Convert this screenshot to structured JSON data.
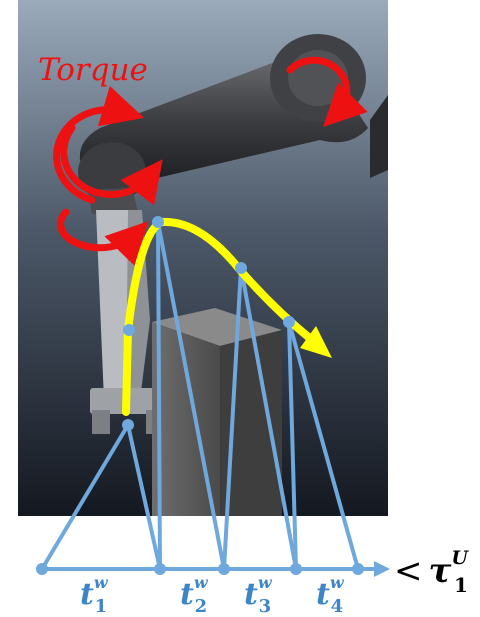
{
  "figure": {
    "torque_label": "Torque",
    "time_labels": [
      {
        "base": "t",
        "sub": "1",
        "sup": "w"
      },
      {
        "base": "t",
        "sub": "2",
        "sup": "w"
      },
      {
        "base": "t",
        "sub": "3",
        "sup": "w"
      },
      {
        "base": "t",
        "sub": "4",
        "sup": "w"
      }
    ],
    "bound_label": {
      "op": "<",
      "base": "τ",
      "sub": "1",
      "sup": "U"
    }
  },
  "colors": {
    "torque": "#ee1111",
    "trajectory": "#ffff00",
    "timeline": "#6fa8dc",
    "label_blue": "#3d85c6",
    "scene_top": "#8a9bb0",
    "scene_bottom": "#141820"
  }
}
